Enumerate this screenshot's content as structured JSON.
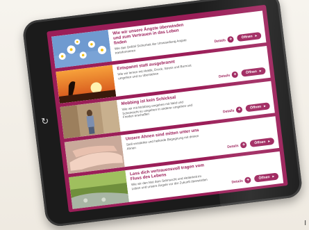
{
  "screen": {
    "accent": "#9b1e58",
    "home_icon": "refresh-icon"
  },
  "items": [
    {
      "title": "Wie wir unsere Ängste überwinden und zum Vertrauen in das Leben finden",
      "description": "Wie das Gefühl Sicherheit der Umwandlung Angste transformieren",
      "details_label": "Details",
      "open_label": "Öffnen",
      "image": "daisies"
    },
    {
      "title": "Entspannt statt ausgebrannt",
      "description": "Wie wir lernen mit Hektik, Druck, Stress und Burnout umgehen und zu überstehen",
      "details_label": "Details",
      "open_label": "Öffnen",
      "image": "sunset-silhouette"
    },
    {
      "title": "Mobbing ist kein Schicksal",
      "description": "Wie wir mit Mobbing umgehen mit Neid und Scheinsicht so umgehen in anderer umgehen und Frieden erschaffen",
      "details_label": "Details",
      "open_label": "Öffnen",
      "image": "sad-person"
    },
    {
      "title": "Unsere Ahnen sind mitten unter uns",
      "description": "Stell verstärkte und heilende Begegnung mit deinen Ahnen",
      "details_label": "Details",
      "open_label": "Öffnen",
      "image": "hands"
    },
    {
      "title": "Lass dich vertrauensvoll tragen vom Fluss des Lebens",
      "description": "Wie wir den Mut dem Sehnsucht und Heiterkeit im Leben und unsere Ängste vor der Zukunft überwinden",
      "details_label": "Details",
      "open_label": "Öffnen",
      "image": "forest-stream"
    }
  ],
  "corner_text": "I"
}
